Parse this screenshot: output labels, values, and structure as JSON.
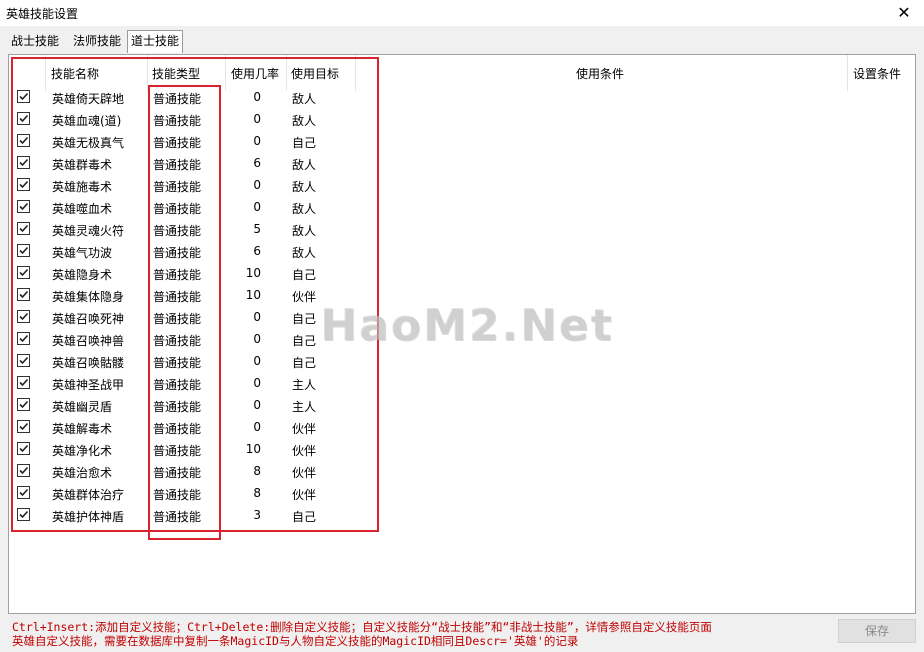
{
  "window": {
    "title": "英雄技能设置",
    "close_glyph": "✕"
  },
  "tabs": [
    "战士技能",
    "法师技能",
    "道士技能"
  ],
  "table": {
    "headers": {
      "name": "技能名称",
      "type": "技能类型",
      "rate": "使用几率",
      "target": "使用目标",
      "condition": "使用条件",
      "settings": "设置条件"
    },
    "rows": [
      {
        "checked": true,
        "name": "英雄倚天辟地",
        "type": "普通技能",
        "rate": "0",
        "target": "敌人"
      },
      {
        "checked": true,
        "name": "英雄血魂(道)",
        "type": "普通技能",
        "rate": "0",
        "target": "敌人"
      },
      {
        "checked": true,
        "name": "英雄无极真气",
        "type": "普通技能",
        "rate": "0",
        "target": "自己"
      },
      {
        "checked": true,
        "name": "英雄群毒术",
        "type": "普通技能",
        "rate": "6",
        "target": "敌人"
      },
      {
        "checked": true,
        "name": "英雄施毒术",
        "type": "普通技能",
        "rate": "0",
        "target": "敌人"
      },
      {
        "checked": true,
        "name": "英雄噬血术",
        "type": "普通技能",
        "rate": "0",
        "target": "敌人"
      },
      {
        "checked": true,
        "name": "英雄灵魂火符",
        "type": "普通技能",
        "rate": "5",
        "target": "敌人"
      },
      {
        "checked": true,
        "name": "英雄气功波",
        "type": "普通技能",
        "rate": "6",
        "target": "敌人"
      },
      {
        "checked": true,
        "name": "英雄隐身术",
        "type": "普通技能",
        "rate": "10",
        "target": "自己"
      },
      {
        "checked": true,
        "name": "英雄集体隐身",
        "type": "普通技能",
        "rate": "10",
        "target": "伙伴"
      },
      {
        "checked": true,
        "name": "英雄召唤死神",
        "type": "普通技能",
        "rate": "0",
        "target": "自己"
      },
      {
        "checked": true,
        "name": "英雄召唤神兽",
        "type": "普通技能",
        "rate": "0",
        "target": "自己"
      },
      {
        "checked": true,
        "name": "英雄召唤骷髅",
        "type": "普通技能",
        "rate": "0",
        "target": "自己"
      },
      {
        "checked": true,
        "name": "英雄神圣战甲",
        "type": "普通技能",
        "rate": "0",
        "target": "主人"
      },
      {
        "checked": true,
        "name": "英雄幽灵盾",
        "type": "普通技能",
        "rate": "0",
        "target": "主人"
      },
      {
        "checked": true,
        "name": "英雄解毒术",
        "type": "普通技能",
        "rate": "0",
        "target": "伙伴"
      },
      {
        "checked": true,
        "name": "英雄净化术",
        "type": "普通技能",
        "rate": "10",
        "target": "伙伴"
      },
      {
        "checked": true,
        "name": "英雄治愈术",
        "type": "普通技能",
        "rate": "8",
        "target": "伙伴"
      },
      {
        "checked": true,
        "name": "英雄群体治疗",
        "type": "普通技能",
        "rate": "8",
        "target": "伙伴"
      },
      {
        "checked": true,
        "name": "英雄护体神盾",
        "type": "普通技能",
        "rate": "3",
        "target": "自己"
      }
    ]
  },
  "watermark": "HaoM2.Net",
  "footer": {
    "line1": "Ctrl+Insert:添加自定义技能；Ctrl+Delete:删除自定义技能；自定义技能分“战士技能”和“非战士技能”，详情参照自定义技能页面",
    "line2": "英雄自定义技能，需要在数据库中复制一条MagicID与人物自定义技能的MagicID相同且Descr='英雄'的记录",
    "save_label": "保存"
  },
  "colors": {
    "highlight_box": "#d9232e",
    "footnote": "#c00000"
  }
}
